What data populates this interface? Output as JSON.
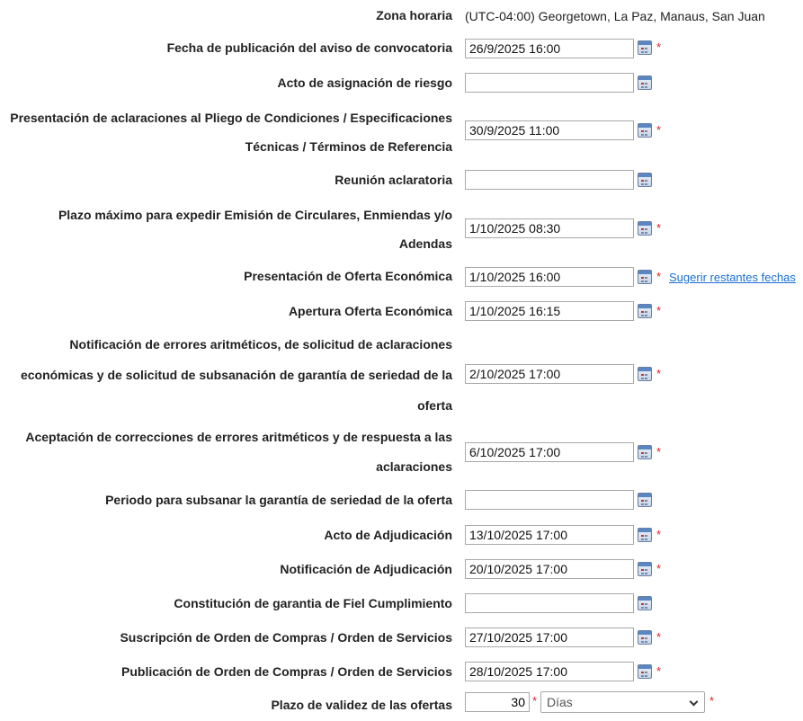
{
  "timezone": {
    "label": "Zona horaria",
    "value": "(UTC-04:00) Georgetown, La Paz, Manaus, San Juan"
  },
  "fields": [
    {
      "label": "Fecha de publicación del aviso de convocatoria",
      "value": "26/9/2025 16:00",
      "required": "*"
    },
    {
      "label": "Acto de asignación de riesgo",
      "value": "",
      "required": ""
    },
    {
      "label": "Presentación de aclaraciones al Pliego de Condiciones / Especificaciones Técnicas / Términos de Referencia",
      "value": "30/9/2025 11:00",
      "required": "*"
    },
    {
      "label": "Reunión aclaratoria",
      "value": "",
      "required": ""
    },
    {
      "label": "Plazo máximo para expedir Emisión de Circulares, Enmiendas y/o Adendas",
      "value": "1/10/2025 08:30",
      "required": "*"
    },
    {
      "label": "Presentación de Oferta Económica",
      "value": "1/10/2025 16:00",
      "required": "*",
      "link": "Sugerir restantes fechas"
    },
    {
      "label": "Apertura Oferta Económica",
      "value": "1/10/2025 16:15",
      "required": "*"
    },
    {
      "label": "Notificación de errores aritméticos, de solicitud de aclaraciones económicas y de solicitud de subsanación de garantía de seriedad de la oferta",
      "value": "2/10/2025 17:00",
      "required": "*"
    },
    {
      "label": "Aceptación de correcciones de errores aritméticos y de respuesta a las aclaraciones",
      "value": "6/10/2025 17:00",
      "required": "*"
    },
    {
      "label": "Periodo para subsanar la garantía de seriedad de la oferta",
      "value": "",
      "required": ""
    },
    {
      "label": "Acto de Adjudicación",
      "value": "13/10/2025 17:00",
      "required": "*"
    },
    {
      "label": "Notificación de Adjudicación",
      "value": "20/10/2025 17:00",
      "required": "*"
    },
    {
      "label": "Constitución de garantia de Fiel Cumplimiento",
      "value": "",
      "required": ""
    },
    {
      "label": "Suscripción de Orden de Compras / Orden de Servicios",
      "value": "27/10/2025 17:00",
      "required": "*"
    },
    {
      "label": "Publicación de Orden de Compras / Orden de Servicios",
      "value": "28/10/2025 17:00",
      "required": "*"
    }
  ],
  "validity": {
    "label": "Plazo de validez de las ofertas",
    "number": "30",
    "required": "*",
    "unit": "Días",
    "unit_required": "*"
  },
  "icons": {
    "calendar": "calendar-icon",
    "dropdown": "chevron-down-icon"
  },
  "colors": {
    "required": "#e02020",
    "link": "#1a6fd1"
  }
}
